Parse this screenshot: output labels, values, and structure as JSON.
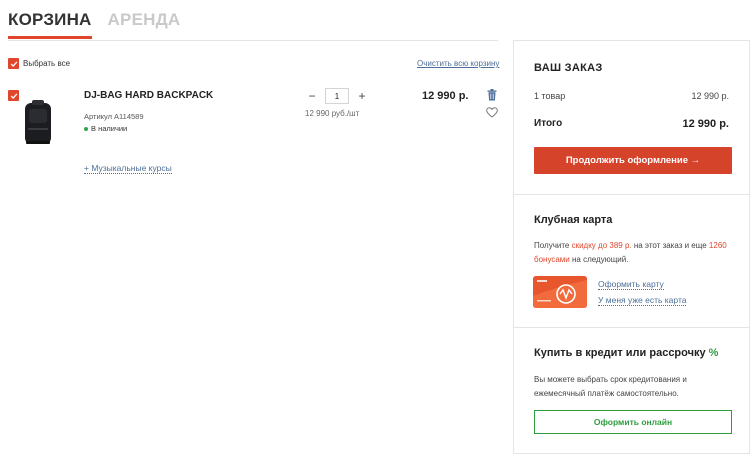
{
  "tabs": [
    {
      "label": "КОРЗИНА",
      "active": true
    },
    {
      "label": "АРЕНДА",
      "active": false
    }
  ],
  "cart": {
    "select_all_label": "Выбрать все",
    "clear_label": "Очистить всю корзину",
    "item": {
      "title": "DJ-BAG HARD BACKPACK",
      "sku": "Артикул A114589",
      "stock": "В наличии",
      "quantity": "1",
      "qty_minus": "−",
      "qty_plus": "+",
      "unit_price": "12 990 руб./шт",
      "total": "12 990 р."
    },
    "courses_link": "+ Музыкальные курсы"
  },
  "order": {
    "title": "ВАШ ЗАКАЗ",
    "count_label": "1 товар",
    "count_sum": "12 990 р.",
    "total_label": "Итого",
    "total_value": "12 990 р.",
    "checkout_label": "Продолжить оформление →"
  },
  "club": {
    "title": "Клубная карта",
    "text_prefix": "Получите ",
    "discount": "скидку до 389 р.",
    "text_middle": " на этот заказ и еще ",
    "bonus": "1260 бонусами",
    "text_suffix": " на следующий.",
    "link_apply": "Оформить карту",
    "link_have": "У меня уже есть карта"
  },
  "credit": {
    "title": "Купить в кредит или рассрочку ",
    "title_pct": "%",
    "text": "Вы можете выбрать срок кредитования и ежемесячный платёж самостоятельно.",
    "button_label": "Оформить онлайн"
  },
  "colors": {
    "accent": "#e0462c",
    "button": "#d5432b",
    "link": "#4d6f99",
    "credit_green": "#2e9e3e",
    "stock_green": "#2da44e"
  }
}
